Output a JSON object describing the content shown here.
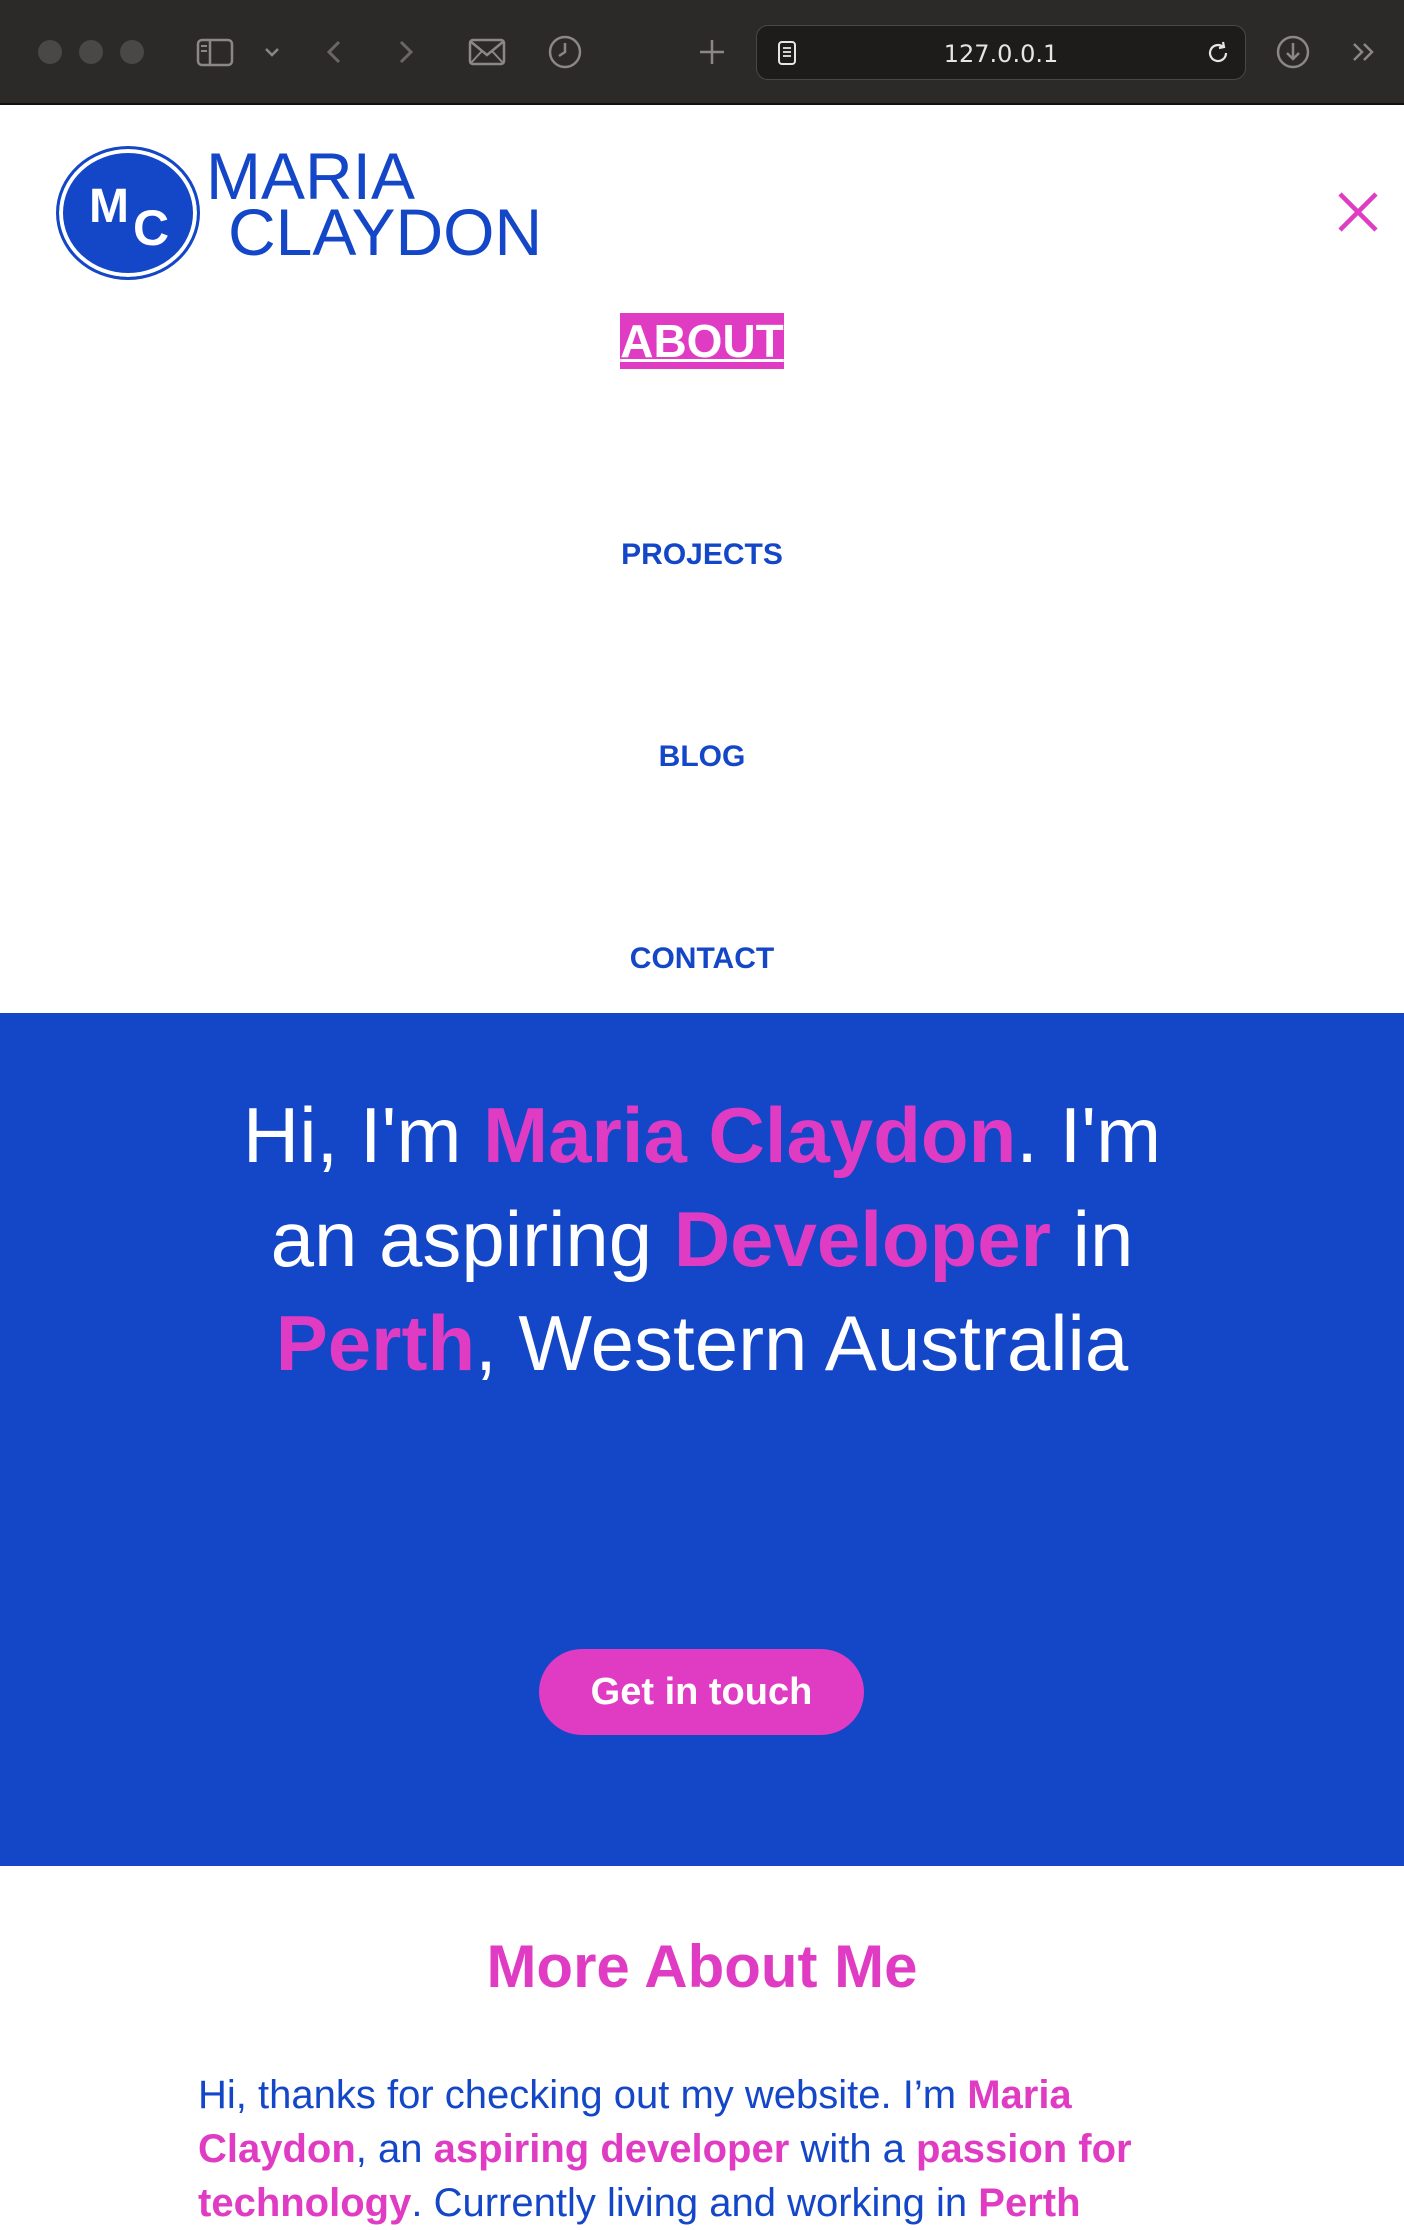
{
  "browser": {
    "url": "127.0.0.1",
    "icons": [
      "sidebar-icon",
      "chevron-down-icon",
      "back-icon",
      "forward-icon",
      "mail-icon",
      "history-icon",
      "new-tab-icon",
      "page-icon",
      "reload-icon",
      "download-icon",
      "more-icon"
    ]
  },
  "header": {
    "logo_initial_m": "M",
    "logo_initial_c": "C",
    "logo_line1": "MARIA",
    "logo_line2": "CLAYDON",
    "close_icon": "close-icon"
  },
  "nav": {
    "items": [
      {
        "label": "ABOUT"
      },
      {
        "label": "PROJECTS"
      },
      {
        "label": "BLOG"
      },
      {
        "label": "CONTACT"
      }
    ]
  },
  "hero": {
    "t1": "Hi, I'm ",
    "h1": "Maria Claydon",
    "t2": ". I'm an aspiring ",
    "h2": "Developer",
    "t3": " in ",
    "h3": "Perth",
    "t4": ", Western Australia",
    "cta_label": "Get in touch"
  },
  "about": {
    "title": "More About Me",
    "t1": "Hi, thanks for checking out my website. I’m ",
    "h1": "Maria Claydon",
    "t2": ", an ",
    "h2": "aspiring developer",
    "t3": " with a ",
    "h3": "passion for technology",
    "t4": ". Currently living and working in ",
    "h4": "Perth"
  },
  "colors": {
    "brand_blue": "#1446c8",
    "accent_pink": "#e03cc3",
    "chrome_dark": "#2c2a28"
  }
}
